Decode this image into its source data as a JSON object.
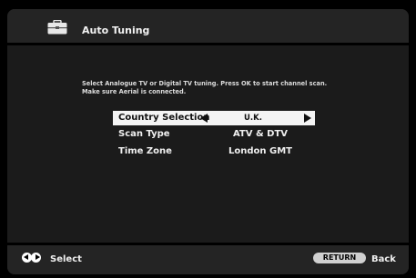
{
  "header": {
    "title": "Auto Tuning",
    "icon": "toolbox-icon"
  },
  "instructions": {
    "line1": "Select Analogue TV or Digital TV tuning. Press OK to start channel scan.",
    "line2": "Make sure Aerial is connected."
  },
  "settings": [
    {
      "label": "Country Selection",
      "value": "U.K.",
      "selected": true
    },
    {
      "label": "Scan Type",
      "value": "ATV & DTV",
      "selected": false
    },
    {
      "label": "Time Zone",
      "value": "London GMT",
      "selected": false
    }
  ],
  "footer": {
    "select_label": "Select",
    "return_button": "RETURN",
    "back_label": "Back"
  },
  "colors": {
    "background": "#1b1b1b",
    "bar": "#242424",
    "highlight": "#f4f4f4"
  }
}
